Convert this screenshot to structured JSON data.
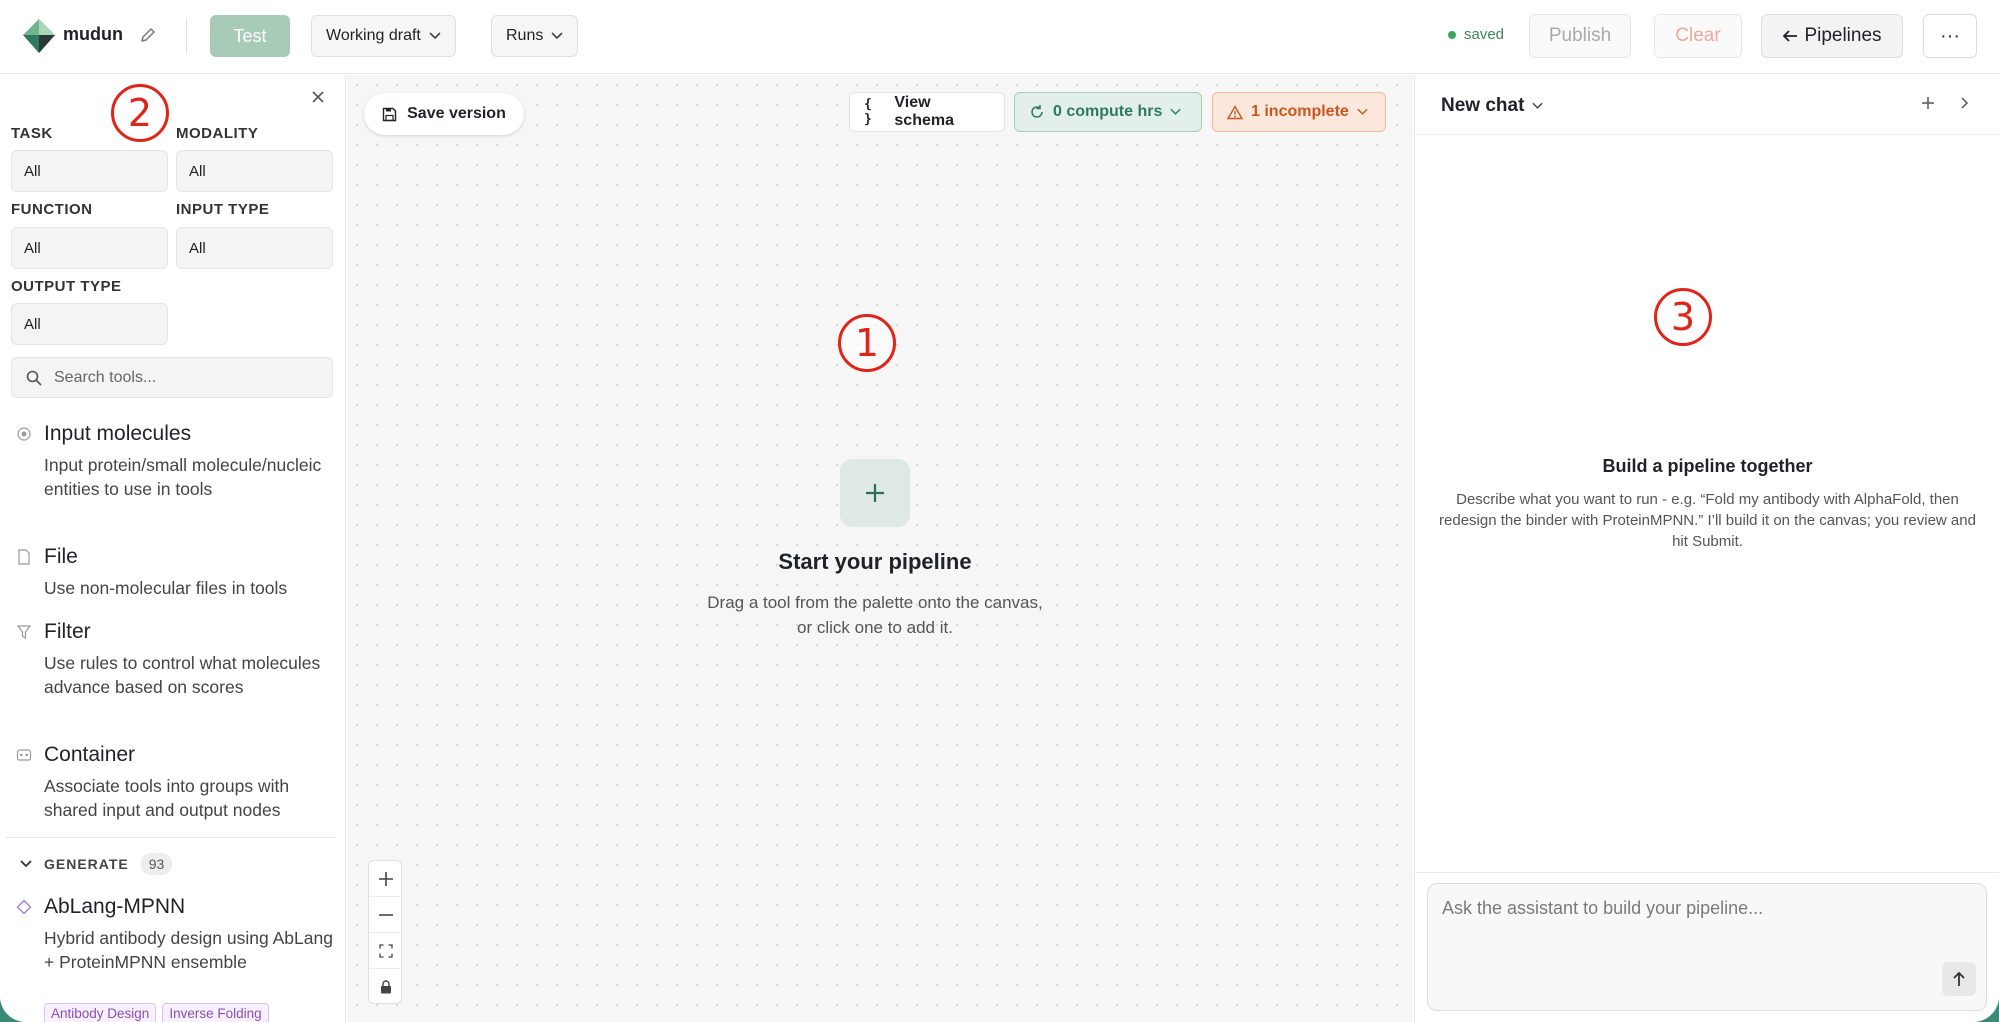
{
  "topbar": {
    "app_name": "mudun",
    "test_label": "Test",
    "draft_label": "Working draft",
    "runs_label": "Runs",
    "saved_label": "saved",
    "publish_label": "Publish",
    "clear_label": "Clear",
    "pipelines_label": "Pipelines",
    "more_label": "···"
  },
  "palette": {
    "filters": [
      {
        "label": "TASK",
        "value": "All"
      },
      {
        "label": "MODALITY",
        "value": "All"
      },
      {
        "label": "FUNCTION",
        "value": "All"
      },
      {
        "label": "INPUT TYPE",
        "value": "All"
      },
      {
        "label": "OUTPUT TYPE",
        "value": "All"
      }
    ],
    "search_placeholder": "Search tools...",
    "tools": [
      {
        "name": "Input molecules",
        "desc": "Input protein/small molecule/nucleic entities to use in tools",
        "icon": "radio-dot-icon"
      },
      {
        "name": "File",
        "desc": "Use non-molecular files in tools",
        "icon": "file-icon"
      },
      {
        "name": "Filter",
        "desc": "Use rules to control what molecules advance based on scores",
        "icon": "filter-icon"
      },
      {
        "name": "Container",
        "desc": "Associate tools into groups with shared input and output nodes",
        "icon": "container-icon"
      }
    ],
    "section": {
      "name": "GENERATE",
      "count": "93"
    },
    "section_tool": {
      "name": "AbLang-MPNN",
      "desc": "Hybrid antibody design using AbLang + ProteinMPNN ensemble",
      "tags": [
        "Antibody Design",
        "Inverse Folding"
      ]
    }
  },
  "canvas": {
    "save_version_label": "Save version",
    "view_schema_label": "View schema",
    "compute_label": "0 compute hrs",
    "incomplete_label": "1 incomplete",
    "empty_title": "Start your pipeline",
    "empty_desc": "Drag a tool from the palette onto the canvas, or click one to add it."
  },
  "chat": {
    "title": "New chat",
    "empty_title": "Build a pipeline together",
    "empty_desc": "Describe what you want to run - e.g. “Fold my antibody with AlphaFold, then redesign the binder with ProteinMPNN.” I’ll build it on the canvas; you review and hit Submit.",
    "input_placeholder": "Ask the assistant to build your pipeline..."
  },
  "markers": [
    "1",
    "2",
    "3"
  ],
  "colors": {
    "brand_green": "#3a8a79",
    "test_button": "#a8cbb7",
    "annotation_red": "#e02418",
    "tag_purple": "#8a4fb8"
  }
}
